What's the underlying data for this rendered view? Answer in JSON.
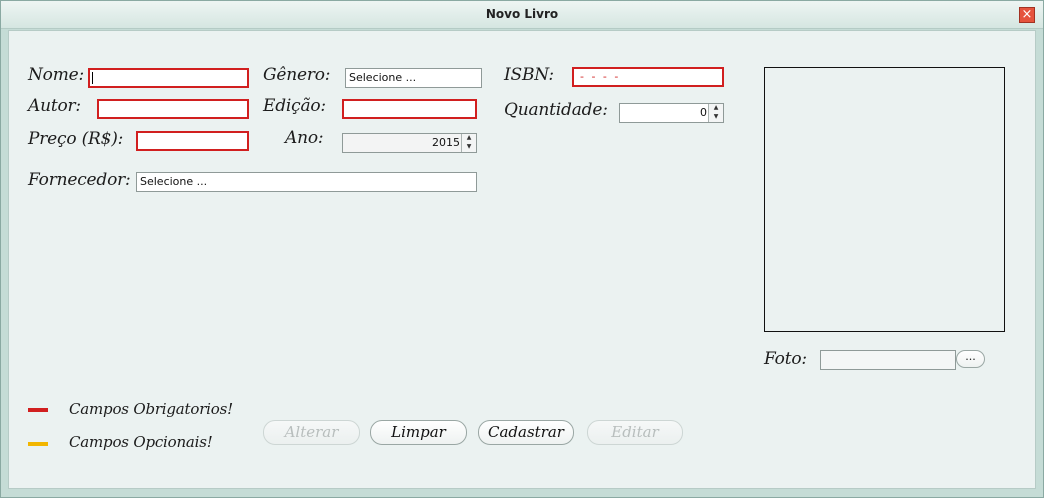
{
  "window": {
    "title": "Novo Livro",
    "close_icon": "close-icon"
  },
  "form": {
    "nome_label": "Nome:",
    "autor_label": "Autor:",
    "preco_label": "Preço (R$):",
    "genero_label": "Gênero:",
    "genero_value": "Selecione ...",
    "edicao_label": "Edição:",
    "ano_label": "Ano:",
    "ano_value": "2015",
    "isbn_label": "ISBN:",
    "isbn_mask": "- -  -  -",
    "quantidade_label": "Quantidade:",
    "quantidade_value": "0",
    "fornecedor_label": "Fornecedor:",
    "fornecedor_value": "Selecione ...",
    "foto_label": "Foto:",
    "browse_label": "..."
  },
  "legend": {
    "required_label": "Campos Obrigatorios!",
    "optional_label": "Campos Opcionais!",
    "required_color": "#d11f1f",
    "optional_color": "#f2b600"
  },
  "buttons": {
    "alterar": "Alterar",
    "limpar": "Limpar",
    "cadastrar": "Cadastrar",
    "editar": "Editar"
  }
}
